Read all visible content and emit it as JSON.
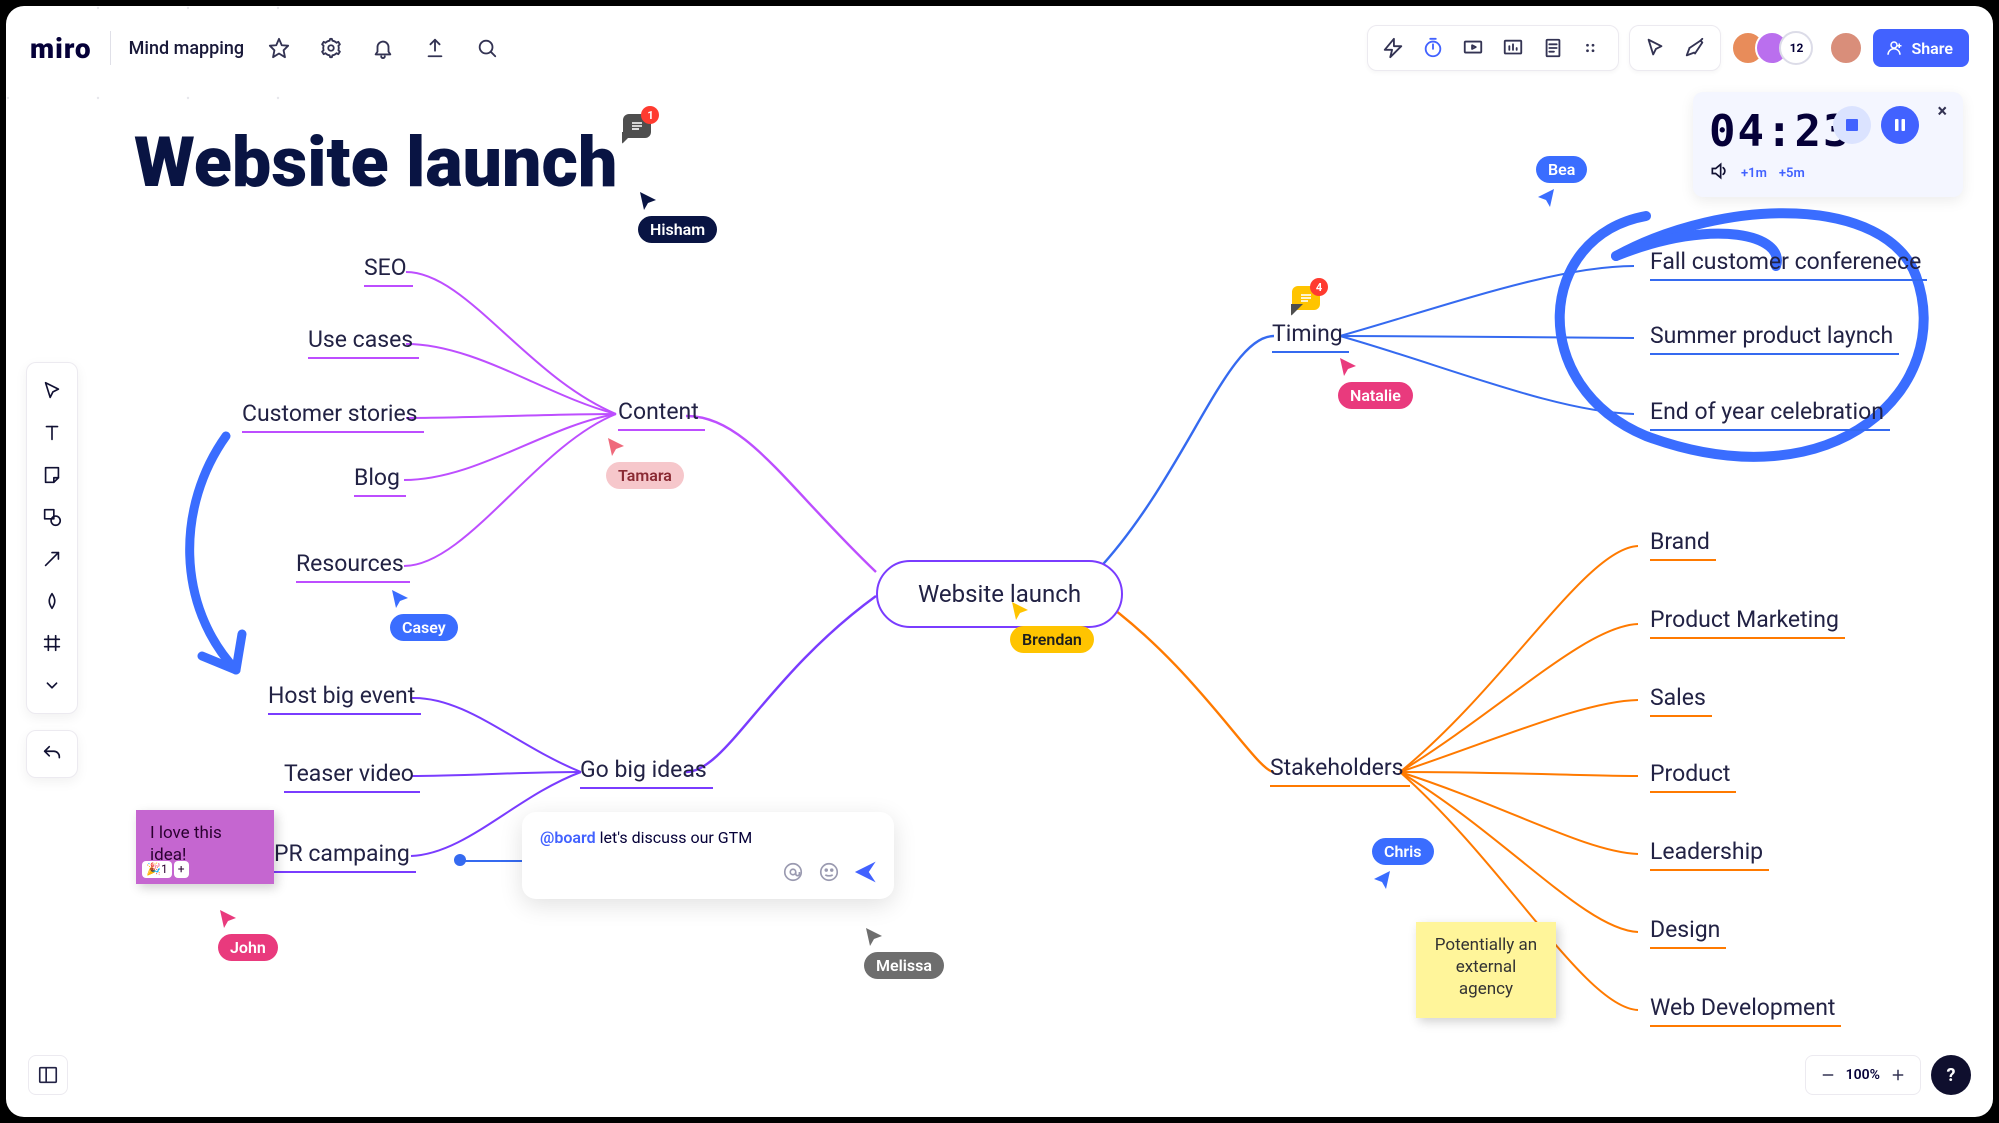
{
  "app": {
    "logo": "miro",
    "board_name": "Mind mapping"
  },
  "topbar_right": {
    "participant_count": "12",
    "share_label": "Share"
  },
  "timer": {
    "digits": "04:23",
    "add_1m": "+1m",
    "add_5m": "+5m"
  },
  "title": {
    "text": "Website launch",
    "comment_count": "1"
  },
  "mindmap": {
    "center": "Website launch",
    "content": {
      "label": "Content",
      "children": [
        "SEO",
        "Use cases",
        "Customer stories",
        "Blog",
        "Resources"
      ]
    },
    "gobig": {
      "label": "Go big ideas",
      "children": [
        "Host big event",
        "Teaser video",
        "PR campaing"
      ]
    },
    "timing": {
      "label": "Timing",
      "comment_count": "4",
      "children": [
        "Fall customer conferenece",
        "Summer product laynch",
        "End of year celebration"
      ]
    },
    "stakeholders": {
      "label": "Stakeholders",
      "children": [
        "Brand",
        "Product Marketing",
        "Sales",
        "Product",
        "Leadership",
        "Design",
        "Web Development"
      ]
    }
  },
  "sticky_pink": {
    "text": "I love this idea!",
    "emoji1": "🎉1",
    "emoji2": "+"
  },
  "sticky_yellow": {
    "text": "Potentially an external agency"
  },
  "cursors": {
    "hisham": "Hisham",
    "bea": "Bea",
    "natalie": "Natalie",
    "tamara": "Tamara",
    "casey": "Casey",
    "brendan": "Brendan",
    "john": "John",
    "melissa": "Melissa",
    "chris": "Chris"
  },
  "comment_box": {
    "mention": "@board",
    "text": " let's discuss our GTM"
  },
  "zoom": {
    "level": "100%"
  },
  "help": "?"
}
